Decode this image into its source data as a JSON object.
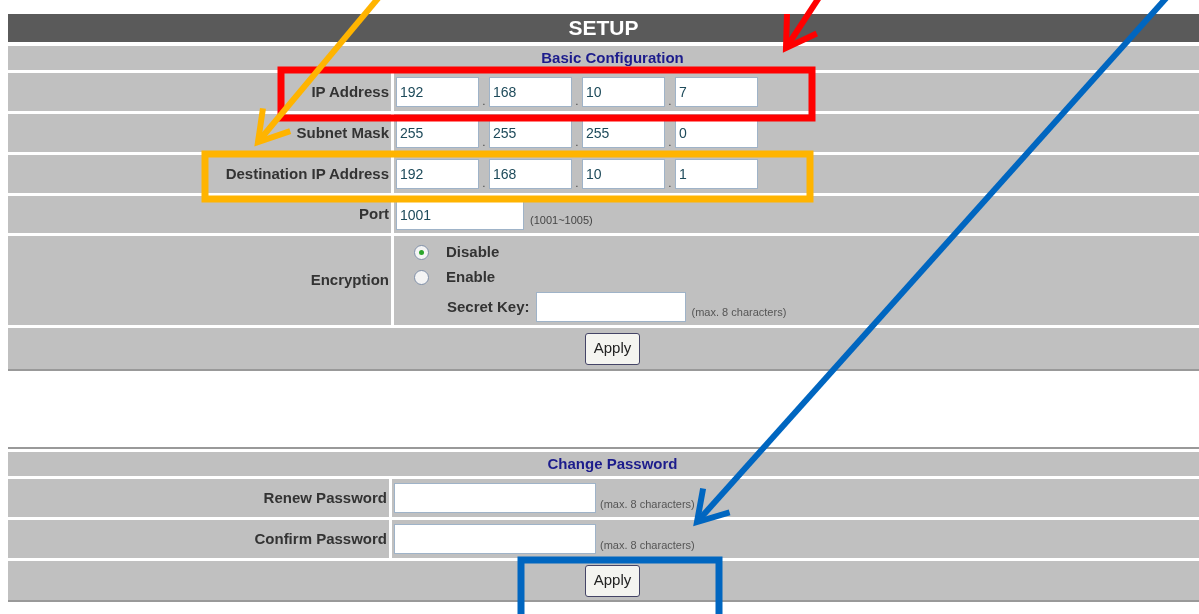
{
  "header": {
    "title": "SETUP"
  },
  "basic": {
    "title": "Basic Configuration",
    "ip_rows": [
      {
        "label": "IP Address",
        "separator": ".",
        "octets": [
          "192",
          "168",
          "10",
          "7"
        ]
      },
      {
        "label": "Subnet Mask",
        "separator": ".",
        "octets": [
          "255",
          "255",
          "255",
          "0"
        ]
      },
      {
        "label": "Destination IP Address",
        "separator": ".",
        "octets": [
          "192",
          "168",
          "10",
          "1"
        ]
      }
    ],
    "port": {
      "label": "Port",
      "value": "1001",
      "hint": "(1001~1005)"
    },
    "encryption": {
      "label": "Encryption",
      "options": [
        {
          "label": "Disable",
          "selected": true
        },
        {
          "label": "Enable",
          "selected": false
        }
      ],
      "secret_key_label": "Secret Key:",
      "hint": "(max. 8 characters)"
    },
    "apply": "Apply"
  },
  "password": {
    "title": "Change Password",
    "rows": [
      {
        "label": "Renew Password",
        "hint": "(max. 8 characters)"
      },
      {
        "label": "Confirm Password",
        "hint": "(max. 8 characters)"
      }
    ],
    "apply": "Apply"
  },
  "annotations": [
    {
      "color": "#ff0000"
    },
    {
      "color": "#ffb400"
    },
    {
      "color": "#0066c0"
    }
  ]
}
